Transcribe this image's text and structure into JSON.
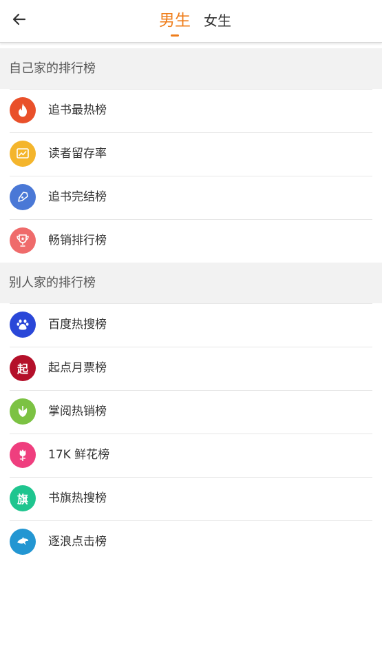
{
  "header": {
    "back_icon": "arrow-left-icon",
    "tabs": [
      {
        "label": "男生",
        "active": true
      },
      {
        "label": "女生",
        "active": false
      }
    ],
    "accent_color": "#ef7d1a"
  },
  "sections": [
    {
      "title": "自己家的排行榜",
      "items": [
        {
          "label": "追书最热榜",
          "icon": "flame-icon",
          "color": "#e9502a"
        },
        {
          "label": "读者留存率",
          "icon": "chart-card-icon",
          "color": "#f4b52c"
        },
        {
          "label": "追书完结榜",
          "icon": "pen-nib-icon",
          "color": "#4a78d6"
        },
        {
          "label": "畅销排行榜",
          "icon": "trophy-icon",
          "color": "#ef6b6b"
        }
      ]
    },
    {
      "title": "别人家的排行榜",
      "items": [
        {
          "label": "百度热搜榜",
          "icon": "baidu-paw-icon",
          "color": "#2a47d8"
        },
        {
          "label": "起点月票榜",
          "icon": "qidian-icon",
          "glyph": "起",
          "color": "#b4102a"
        },
        {
          "label": "掌阅热销榜",
          "icon": "zhangyue-leaf-icon",
          "color": "#7cc243"
        },
        {
          "label": "17K 鲜花榜",
          "icon": "flower-icon",
          "color": "#ef3e7e"
        },
        {
          "label": "书旗热搜榜",
          "icon": "shuqi-icon",
          "glyph": "旗",
          "color": "#1fc58f"
        },
        {
          "label": "逐浪点击榜",
          "icon": "dolphin-icon",
          "color": "#2396d2"
        }
      ]
    }
  ]
}
